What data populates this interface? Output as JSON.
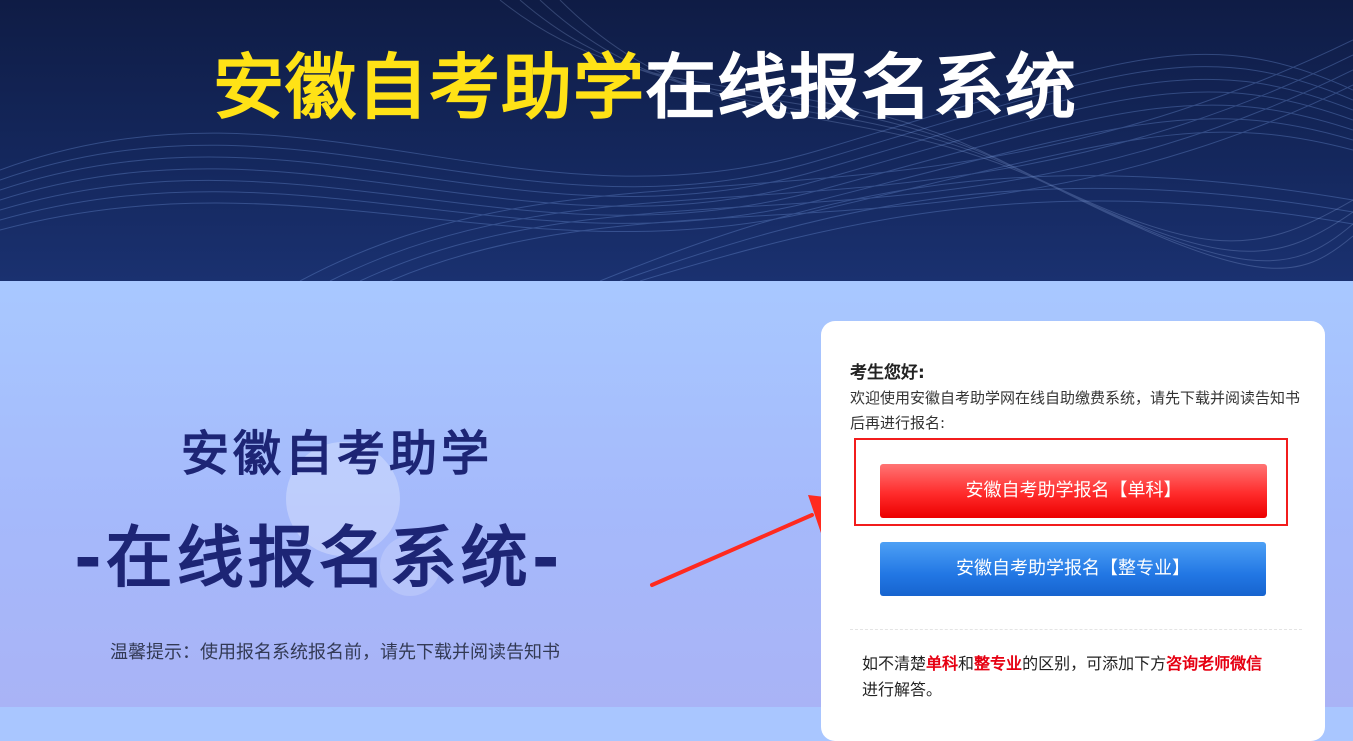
{
  "banner": {
    "title_highlight": "安徽自考助学",
    "title_rest": "在线报名系统"
  },
  "hero": {
    "subtitle_line1": "安徽自考助学",
    "subtitle_line2": "-在线报名系统-",
    "tip": "温馨提示：使用报名系统报名前，请先下载并阅读告知书"
  },
  "card": {
    "greeting": "考生您好:",
    "intro": "欢迎使用安徽自考助学网在线自助缴费系统，请先下载并阅读告知书后再进行报名:",
    "button_single_label": "安徽自考助学报名【单科】",
    "button_full_label": "安徽自考助学报名【整专业】",
    "note": {
      "part1": "如不清楚",
      "red1": "单科",
      "part2": "和",
      "red2": "整专业",
      "part3": "的区别，可添加下方",
      "red3": "咨询老师微信",
      "part4": "进行解答。"
    }
  },
  "colors": {
    "banner_bg": "#14275c",
    "title_yellow": "#ffe216",
    "hero_text": "#1d2575",
    "button_red": "#ff2b2b",
    "button_blue": "#2277e4",
    "highlight_red": "#f21c1c"
  }
}
